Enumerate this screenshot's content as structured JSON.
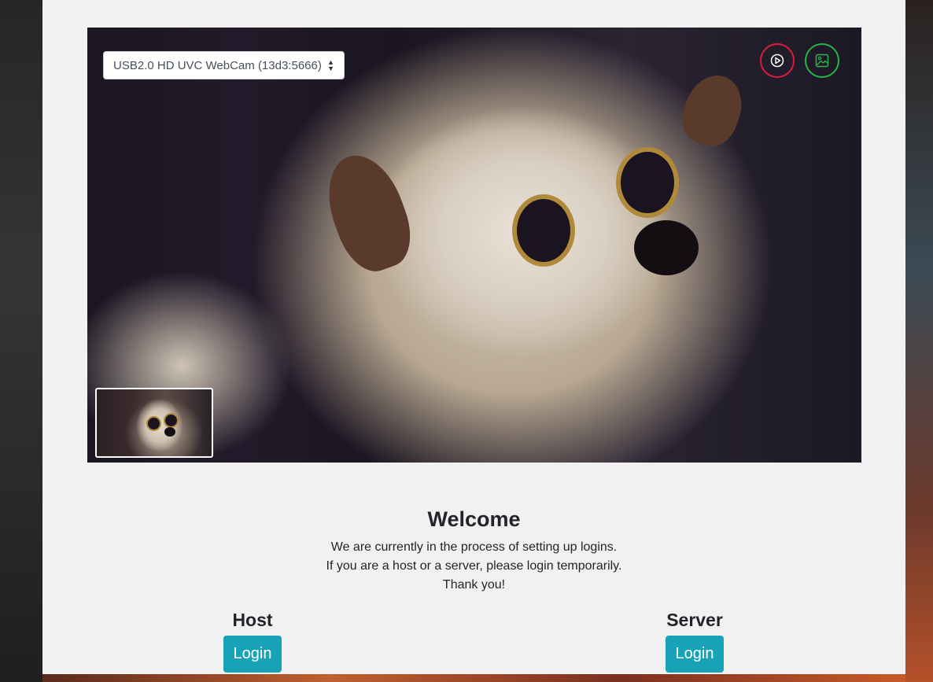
{
  "camera": {
    "selected_device": "USB2.0 HD UVC WebCam (13d3:5666)",
    "record_icon": "play-circle-icon",
    "snapshot_icon": "image-icon",
    "colors": {
      "record": "#dc1e3c",
      "snapshot": "#28b446"
    }
  },
  "welcome": {
    "title": "Welcome",
    "line1": "We are currently in the process of setting up logins.",
    "line2": "If you are a host or a server, please login temporarily.",
    "line3": "Thank you!"
  },
  "roles": {
    "host": {
      "heading": "Host",
      "button": "Login"
    },
    "server": {
      "heading": "Server",
      "button": "Login"
    }
  },
  "colors": {
    "accent": "#17a2b8",
    "panel": "#f1f1f1"
  }
}
